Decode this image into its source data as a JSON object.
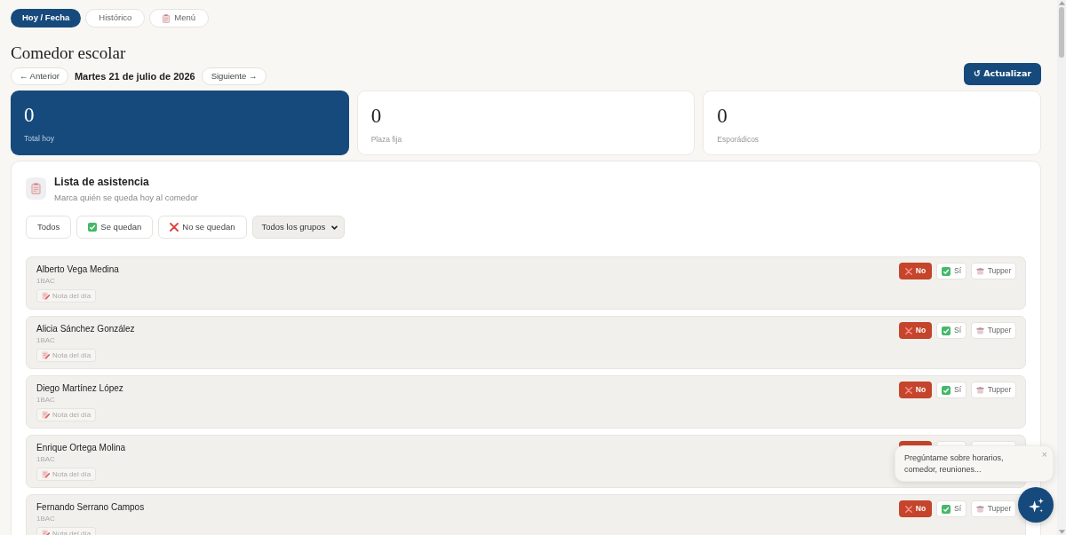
{
  "tabs": [
    {
      "label": "Hoy / Fecha",
      "selected": true,
      "kind": "plain"
    },
    {
      "label": "Histórico",
      "selected": false,
      "kind": "plain"
    },
    {
      "label": "Menú",
      "selected": false,
      "kind": "menu"
    }
  ],
  "page_title": "Comedor escolar",
  "date_nav": {
    "previous": "← Anterior",
    "date": "Martes 21 de julio de 2026",
    "next": "Siguiente →"
  },
  "refresh_button": "↺ Actualizar",
  "stats": [
    {
      "value": "0",
      "label": "Total hoy",
      "selected": true
    },
    {
      "value": "0",
      "label": "Plaza fija",
      "selected": false
    },
    {
      "value": "0",
      "label": "Esporádicos",
      "selected": false
    }
  ],
  "attendance": {
    "title": "Lista de asistencia",
    "subtitle": "Marca quién se queda hoy al comedor",
    "filters": [
      {
        "label": "Todos",
        "kind": "all"
      },
      {
        "label": "Se quedan",
        "kind": "stay"
      },
      {
        "label": "No se quedan",
        "kind": "leave"
      }
    ],
    "group_select": "Todos los grupos",
    "students": [
      {
        "name": "Alberto Vega Medina",
        "group": "1BAC",
        "note": "Nota del día",
        "options": [
          {
            "kind": "no",
            "label": "No",
            "selected": true
          },
          {
            "kind": "yes",
            "label": "Sí",
            "selected": false
          },
          {
            "kind": "tupper",
            "label": "Tupper",
            "selected": false
          }
        ]
      },
      {
        "name": "Alicia Sánchez González",
        "group": "1BAC",
        "note": "Nota del día",
        "options": [
          {
            "kind": "no",
            "label": "No",
            "selected": true
          },
          {
            "kind": "yes",
            "label": "Sí",
            "selected": false
          },
          {
            "kind": "tupper",
            "label": "Tupper",
            "selected": false
          }
        ]
      },
      {
        "name": "Diego Martínez López",
        "group": "1BAC",
        "note": "Nota del día",
        "options": [
          {
            "kind": "no",
            "label": "No",
            "selected": true
          },
          {
            "kind": "yes",
            "label": "Sí",
            "selected": false
          },
          {
            "kind": "tupper",
            "label": "Tupper",
            "selected": false
          }
        ]
      },
      {
        "name": "Enrique Ortega Molina",
        "group": "1BAC",
        "note": "Nota del día",
        "options": [
          {
            "kind": "no",
            "selected": true
          },
          {
            "kind": "yes",
            "selected": false
          },
          {
            "kind": "tupper",
            "selected": false
          }
        ]
      },
      {
        "name": "Fernando Serrano Campos",
        "group": "1BAC",
        "note": "Nota del día",
        "options": [
          {
            "kind": "no",
            "label": "No",
            "selected": true
          },
          {
            "kind": "yes",
            "label": "Sí",
            "selected": false
          },
          {
            "kind": "tupper",
            "label": "Tupper",
            "selected": false
          }
        ]
      }
    ]
  },
  "assistant": {
    "message": "Pregúntame sobre horarios, comedor, reuniones...",
    "close": "×"
  }
}
